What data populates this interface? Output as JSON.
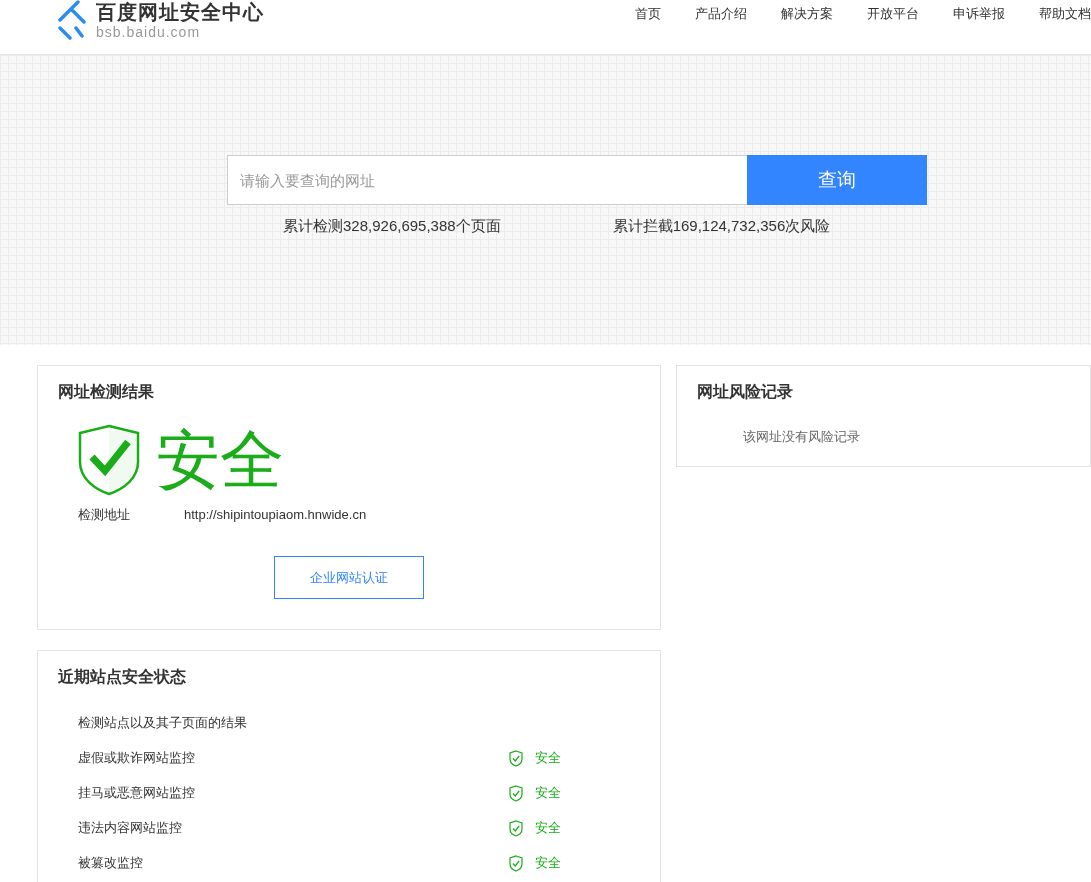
{
  "header": {
    "site_name": "百度网址安全中心",
    "domain": "bsb.baidu.com",
    "nav": [
      {
        "label": "首页"
      },
      {
        "label": "产品介绍"
      },
      {
        "label": "解决方案"
      },
      {
        "label": "开放平台"
      },
      {
        "label": "申诉举报"
      },
      {
        "label": "帮助文档"
      }
    ]
  },
  "search": {
    "placeholder": "请输入要查询的网址",
    "button": "查询",
    "stats": [
      "累计检测328,926,695,388个页面",
      "累计拦截169,124,732,356次风险"
    ]
  },
  "result": {
    "title": "网址检测结果",
    "verdict": "安全",
    "address_label": "检测地址",
    "address": "http://shipintoupiaom.hnwide.cn",
    "button": "企业网站认证"
  },
  "risk": {
    "title": "网址风险记录",
    "message": "该网址没有风险记录"
  },
  "status": {
    "title": "近期站点安全状态",
    "subtitle": "检测站点以及其子页面的结果",
    "items": [
      {
        "label": "虚假或欺诈网站监控",
        "result": "安全"
      },
      {
        "label": "挂马或恶意网站监控",
        "result": "安全"
      },
      {
        "label": "违法内容网站监控",
        "result": "安全"
      },
      {
        "label": "被篡改监控",
        "result": "安全"
      }
    ]
  }
}
